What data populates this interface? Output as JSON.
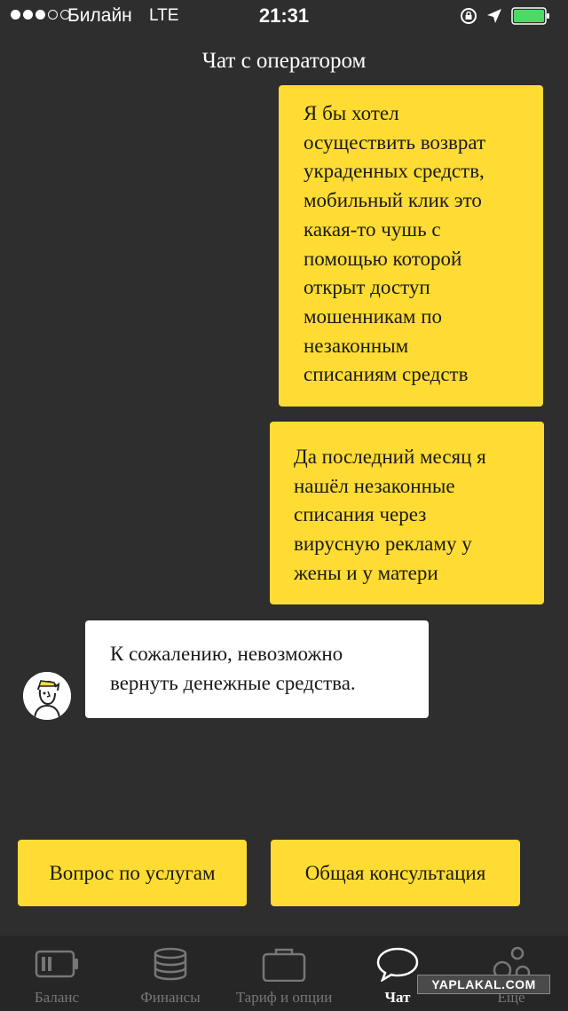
{
  "status_bar": {
    "carrier": "Билайн",
    "network": "LTE",
    "time": "21:31",
    "battery_color": "#4cd964"
  },
  "header": {
    "title": "Чат с оператором"
  },
  "messages": [
    {
      "from": "user",
      "text": "Я бы хотел\nосуществить возврат\nукраденных средств,\nмобильный клик это\nкакая-то чушь с\nпомощью которой\nоткрыт доступ\nмошенникам по\nнезаконным\nсписаниям средств"
    },
    {
      "from": "user",
      "text": "Да последний месяц я\nнашёл незаконные\nсписания через\nвирусную рекламу у\nжены и у матери"
    },
    {
      "from": "operator",
      "text": "К сожалению, невозможно\nвернуть денежные средства."
    }
  ],
  "quick_replies": [
    {
      "label": "Вопрос по услугам"
    },
    {
      "label": "Общая консультация"
    }
  ],
  "tabs": [
    {
      "label": "Баланс",
      "icon": "battery-tab-icon"
    },
    {
      "label": "Финансы",
      "icon": "coins-icon"
    },
    {
      "label": "Тариф и опции",
      "icon": "briefcase-icon"
    },
    {
      "label": "Чат",
      "icon": "chat-bubble-icon",
      "active": true
    },
    {
      "label": "Еще",
      "icon": "bubbles-icon"
    }
  ],
  "watermark": "YAPLAKAL.COM",
  "colors": {
    "background": "#2e2e2e",
    "accent_yellow": "#fedc34",
    "tab_bar": "#262626"
  }
}
